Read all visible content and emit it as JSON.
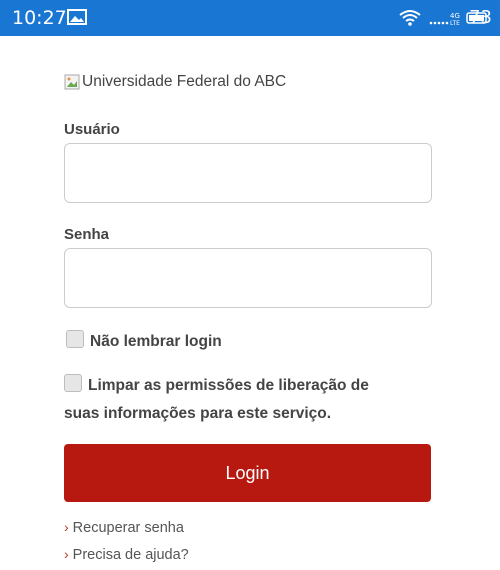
{
  "status_bar": {
    "time": "10:27",
    "battery": "73",
    "background": "#1976d2",
    "icons": [
      "image-notification-icon",
      "wifi-icon",
      "cell-signal-icon",
      "battery-icon"
    ]
  },
  "logo": {
    "alt_text": "Universidade Federal do ABC"
  },
  "form": {
    "username_label": "Usuário",
    "username_value": "",
    "password_label": "Senha",
    "password_value": "",
    "checkbox_no_remember": "Não lembrar login",
    "checkbox_clear_permissions_line1": "Limpar as permissões de liberação de",
    "checkbox_clear_permissions_line2": "suas informações para este serviço.",
    "login_button": "Login",
    "login_button_color": "#b71910"
  },
  "links": {
    "recover_password": "Recuperar senha",
    "need_help": "Precisa de ajuda?",
    "chevron": "›"
  }
}
